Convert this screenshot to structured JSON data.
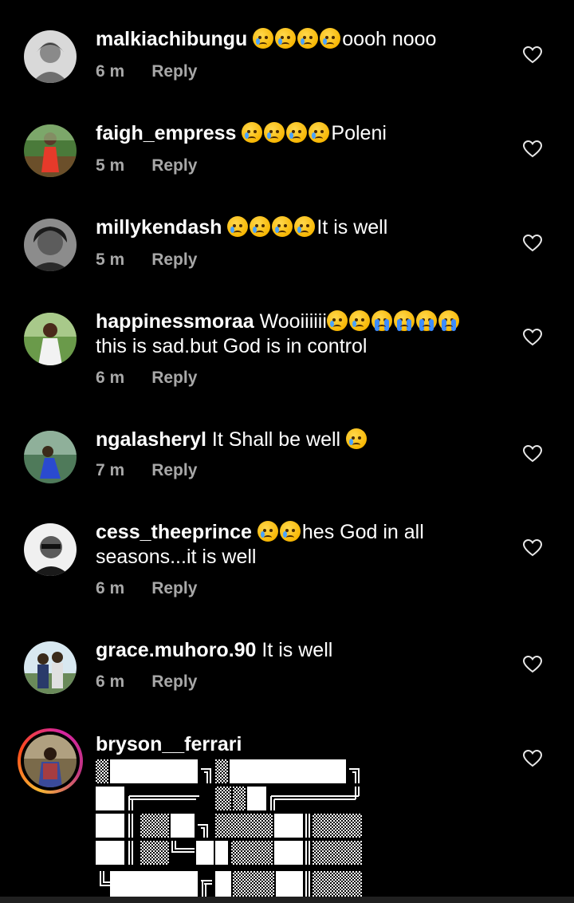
{
  "comments": [
    {
      "username": "malkiachibungu",
      "emojis": [
        "tear",
        "tear",
        "tear",
        "tear"
      ],
      "text": "oooh nooo",
      "line2": "",
      "time": "6 m",
      "reply": "Reply",
      "avatar": "avatar-icon"
    },
    {
      "username": "faigh_empress",
      "emojis": [
        "tear",
        "tear",
        "tear",
        "tear"
      ],
      "text": "Poleni",
      "line2": "",
      "time": "5 m",
      "reply": "Reply",
      "avatar": "avatar-icon"
    },
    {
      "username": "millykendash",
      "emojis": [
        "tear",
        "tear",
        "tear",
        "tear"
      ],
      "text": "It is well",
      "line2": "",
      "time": "5 m",
      "reply": "Reply",
      "avatar": "avatar-icon"
    },
    {
      "username": "happinessmoraa",
      "pre": " Wooiiiiii",
      "emojis": [
        "tear",
        "tear",
        "cry",
        "cry",
        "cry",
        "cry"
      ],
      "text": "",
      "line2": "this is sad.but God is in control",
      "time": "6 m",
      "reply": "Reply",
      "avatar": "avatar-icon"
    },
    {
      "username": "ngalasheryl",
      "pre": " It Shall be well ",
      "emojis": [
        "tear"
      ],
      "text": "",
      "line2": "",
      "time": "7 m",
      "reply": "Reply",
      "avatar": "avatar-icon"
    },
    {
      "username": "cess_theeprince",
      "emojis": [
        "tear",
        "tear"
      ],
      "text": "hes God in all",
      "line2": "seasons...it is well",
      "time": "6 m",
      "reply": "Reply",
      "avatar": "avatar-icon"
    },
    {
      "username": "grace.muhoro.90",
      "pre": " It is well",
      "emojis": [],
      "text": "",
      "line2": "",
      "time": "6 m",
      "reply": "Reply",
      "avatar": "avatar-icon"
    },
    {
      "username": "bryson__ferrari",
      "emojis": [],
      "text": "",
      "line2": "",
      "time": "",
      "reply": "",
      "avatar": "avatar-icon",
      "story_ring": true
    }
  ],
  "icons": {
    "heart": "heart-outline-icon",
    "avatar": "avatar-icon"
  },
  "colors": {
    "background": "#000000",
    "meta_text": "#a8a8a8",
    "text": "#ffffff"
  }
}
